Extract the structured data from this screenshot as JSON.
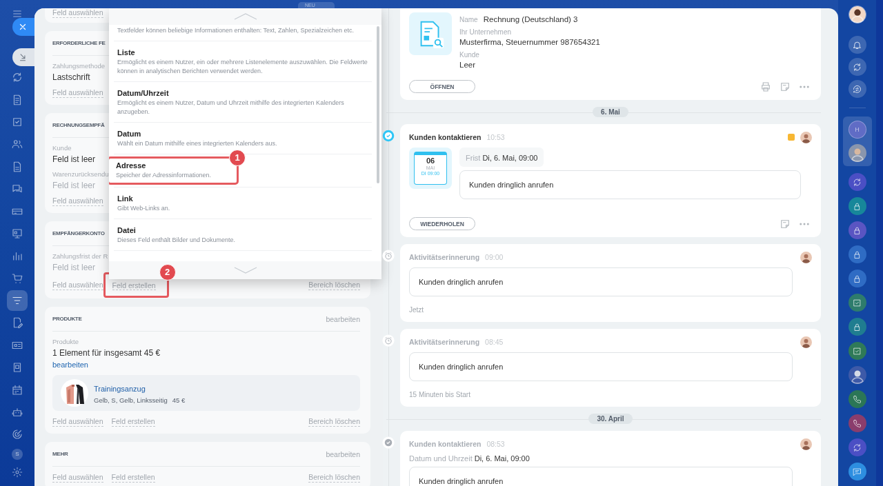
{
  "top_badge": "NEU",
  "left_nav": {
    "items": [
      {
        "kind": "cycle",
        "selected": false
      },
      {
        "kind": "document",
        "selected": false
      },
      {
        "kind": "checkbox",
        "selected": false
      },
      {
        "kind": "people",
        "selected": false
      },
      {
        "kind": "file",
        "selected": false
      },
      {
        "kind": "chat",
        "selected": false
      },
      {
        "kind": "card",
        "selected": false
      },
      {
        "kind": "presentation",
        "selected": false
      },
      {
        "kind": "bar-chart",
        "selected": false
      },
      {
        "kind": "cart",
        "selected": false
      },
      {
        "kind": "filter",
        "selected": true
      },
      {
        "kind": "file-edit",
        "selected": false
      },
      {
        "kind": "id-card",
        "selected": false
      },
      {
        "kind": "box",
        "selected": false
      },
      {
        "kind": "calendar",
        "selected": false
      },
      {
        "kind": "robot",
        "selected": false
      },
      {
        "kind": "target",
        "selected": false
      }
    ],
    "user_initial": "S"
  },
  "sections": [
    {
      "kind": "fragment",
      "actions": [
        {
          "kind": "link",
          "label": "Feld auswählen"
        }
      ]
    },
    {
      "kind": "fields",
      "title": "ERFORDERLICHE FE",
      "fields": [
        {
          "label": "Zahlungsmethode",
          "value": "Lastschrift",
          "muted": false
        }
      ],
      "actions": [
        {
          "kind": "link",
          "label": "Feld auswählen"
        }
      ]
    },
    {
      "kind": "fields",
      "title": "RECHNUNGSEMPFÄ",
      "fields": [
        {
          "label": "Kunde",
          "value": "Feld ist leer",
          "muted": false
        },
        {
          "label": "Warenzurücksendu",
          "value": "Feld ist leer",
          "muted": true
        }
      ],
      "actions": [
        {
          "kind": "link",
          "label": "Feld auswählen"
        }
      ]
    },
    {
      "kind": "fields",
      "title": "EMPFÄNGERKONTO",
      "fields": [
        {
          "label": "Zahlungsfrist der R",
          "value": "Feld ist leer",
          "muted": true
        }
      ],
      "actions": [
        {
          "kind": "link",
          "label": "Feld auswählen"
        },
        {
          "kind": "link",
          "label": "Feld erstellen",
          "callout": "2"
        },
        {
          "kind": "remove",
          "label": "Bereich löschen"
        }
      ]
    },
    {
      "kind": "products",
      "title": "PRODUKTE",
      "edit_label": "bearbeiten",
      "fields": [
        {
          "label": "Produkte",
          "value": "1 Element für insgesamt 45 €",
          "muted": false
        }
      ],
      "link": "bearbeiten",
      "products": [
        {
          "name": "Trainingsanzug",
          "details": "Gelb, S, Gelb, Linksseitig",
          "price": "45 €"
        }
      ],
      "actions": [
        {
          "kind": "link",
          "label": "Feld auswählen"
        },
        {
          "kind": "link",
          "label": "Feld erstellen"
        },
        {
          "kind": "remove",
          "label": "Bereich löschen"
        }
      ]
    },
    {
      "kind": "fields",
      "title": "MEHR",
      "edit_label": "bearbeiten",
      "actions": [
        {
          "kind": "link",
          "label": "Feld auswählen"
        },
        {
          "kind": "link",
          "label": "Feld erstellen"
        },
        {
          "kind": "remove",
          "label": "Bereich löschen"
        }
      ]
    }
  ],
  "dropdown": {
    "items": [
      {
        "description": "Textfelder können beliebige Informationen enthalten: Text, Zahlen, Spezialzeichen etc."
      },
      {
        "title": "Liste",
        "description": "Ermöglicht es einem Nutzer, ein oder mehrere Listenelemente auszuwählen. Die Feldwerte können in analytischen Berichten verwendet werden."
      },
      {
        "title": "Datum/Uhrzeit",
        "description": "Ermöglicht es einem Nutzer, Datum und Uhrzeit mithilfe des integrierten Kalenders anzugeben."
      },
      {
        "title": "Datum",
        "description": "Wählt ein Datum mithilfe eines integrierten Kalenders aus."
      },
      {
        "title": "Adresse",
        "description": "Speicher der Adressinformationen.",
        "callout": "1"
      },
      {
        "title": "Link",
        "description": "Gibt Web-Links an."
      },
      {
        "title": "Datei",
        "description": "Dieses Feld enthält Bilder und Dokumente."
      }
    ]
  },
  "timeline": [
    {
      "kind": "document",
      "name_label": "Name",
      "name": "Rechnung (Deutschland) 3",
      "fields": [
        {
          "label": "Ihr Unternehmen",
          "value": "Musterfirma, Steuernummer 987654321"
        },
        {
          "label": "Kunde",
          "value": "Leer"
        }
      ],
      "button": "ÖFFNEN"
    },
    {
      "kind": "date",
      "label": "6. Mai"
    },
    {
      "kind": "task",
      "title": "Kunden kontaktieren",
      "time": "10:53",
      "calendar": {
        "day": "06",
        "month": "MAI",
        "time": "DI 09:00"
      },
      "deadline_label": "Frist",
      "deadline": "Di, 6. Mai, 09:00",
      "text": "Kunden dringlich anrufen",
      "button": "WIEDERHOLEN"
    },
    {
      "kind": "reminder",
      "title": "Aktivitätserinnerung",
      "time": "09:00",
      "text": "Kunden dringlich anrufen",
      "footer": "Jetzt"
    },
    {
      "kind": "reminder",
      "title": "Aktivitätserinnerung",
      "time": "08:45",
      "text": "Kunden dringlich anrufen",
      "footer": "15 Minuten bis Start"
    },
    {
      "kind": "date",
      "label": "30. April"
    },
    {
      "kind": "done",
      "title": "Kunden kontaktieren",
      "time": "08:53",
      "deadline_label": "Datum und Uhrzeit",
      "deadline": "Di, 6. Mai, 09:00",
      "text": "Kunden dringlich anrufen"
    }
  ],
  "right_rail": {
    "top": [
      {
        "kind": "bell"
      },
      {
        "kind": "cycle"
      },
      {
        "kind": "chat-arrows"
      }
    ],
    "group": [
      {
        "kind": "letter",
        "text": "H"
      },
      {
        "kind": "avatar"
      }
    ],
    "apps": [
      {
        "kind": "cycle",
        "color": "#4b4fc4"
      },
      {
        "kind": "lock",
        "color": "#17879a"
      },
      {
        "kind": "lock",
        "color": "#5a55c2"
      },
      {
        "kind": "lock",
        "color": "#2f6cc4"
      },
      {
        "kind": "lock",
        "color": "#2f6cc4"
      },
      {
        "kind": "checkbox",
        "color": "#2e7c6c"
      },
      {
        "kind": "lock",
        "color": "#1f7d90"
      },
      {
        "kind": "checkbox",
        "color": "#2f7a58"
      },
      {
        "kind": "avatar",
        "color": "#3e5aa8"
      },
      {
        "kind": "phone",
        "color": "#2b7656"
      },
      {
        "kind": "phone",
        "color": "#8a3d6c"
      },
      {
        "kind": "cycle",
        "color": "#4b4fc4"
      },
      {
        "kind": "message",
        "color": "#2d8ee0"
      }
    ]
  }
}
